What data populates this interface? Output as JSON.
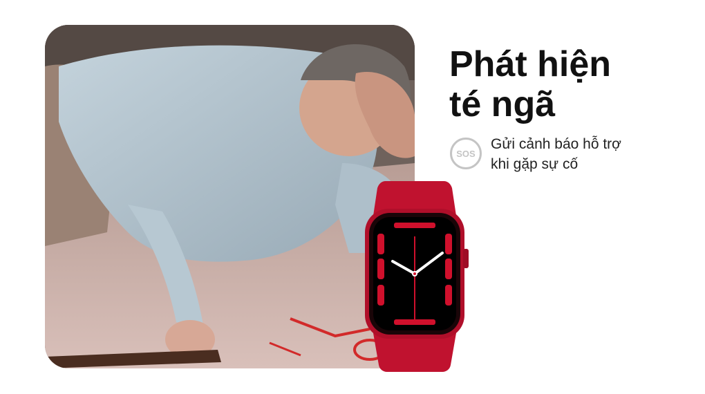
{
  "headline": {
    "line1": "Phát hiện",
    "line2": "té ngã"
  },
  "feature": {
    "icon_name": "sos-icon",
    "icon_label": "SOS",
    "line1": "Gửi cảnh báo hỗ trợ",
    "line2": "khi gặp sự cố"
  },
  "colors": {
    "watch_red": "#c8102e",
    "heading": "#111111",
    "icon_gray": "#c4c4c4"
  }
}
